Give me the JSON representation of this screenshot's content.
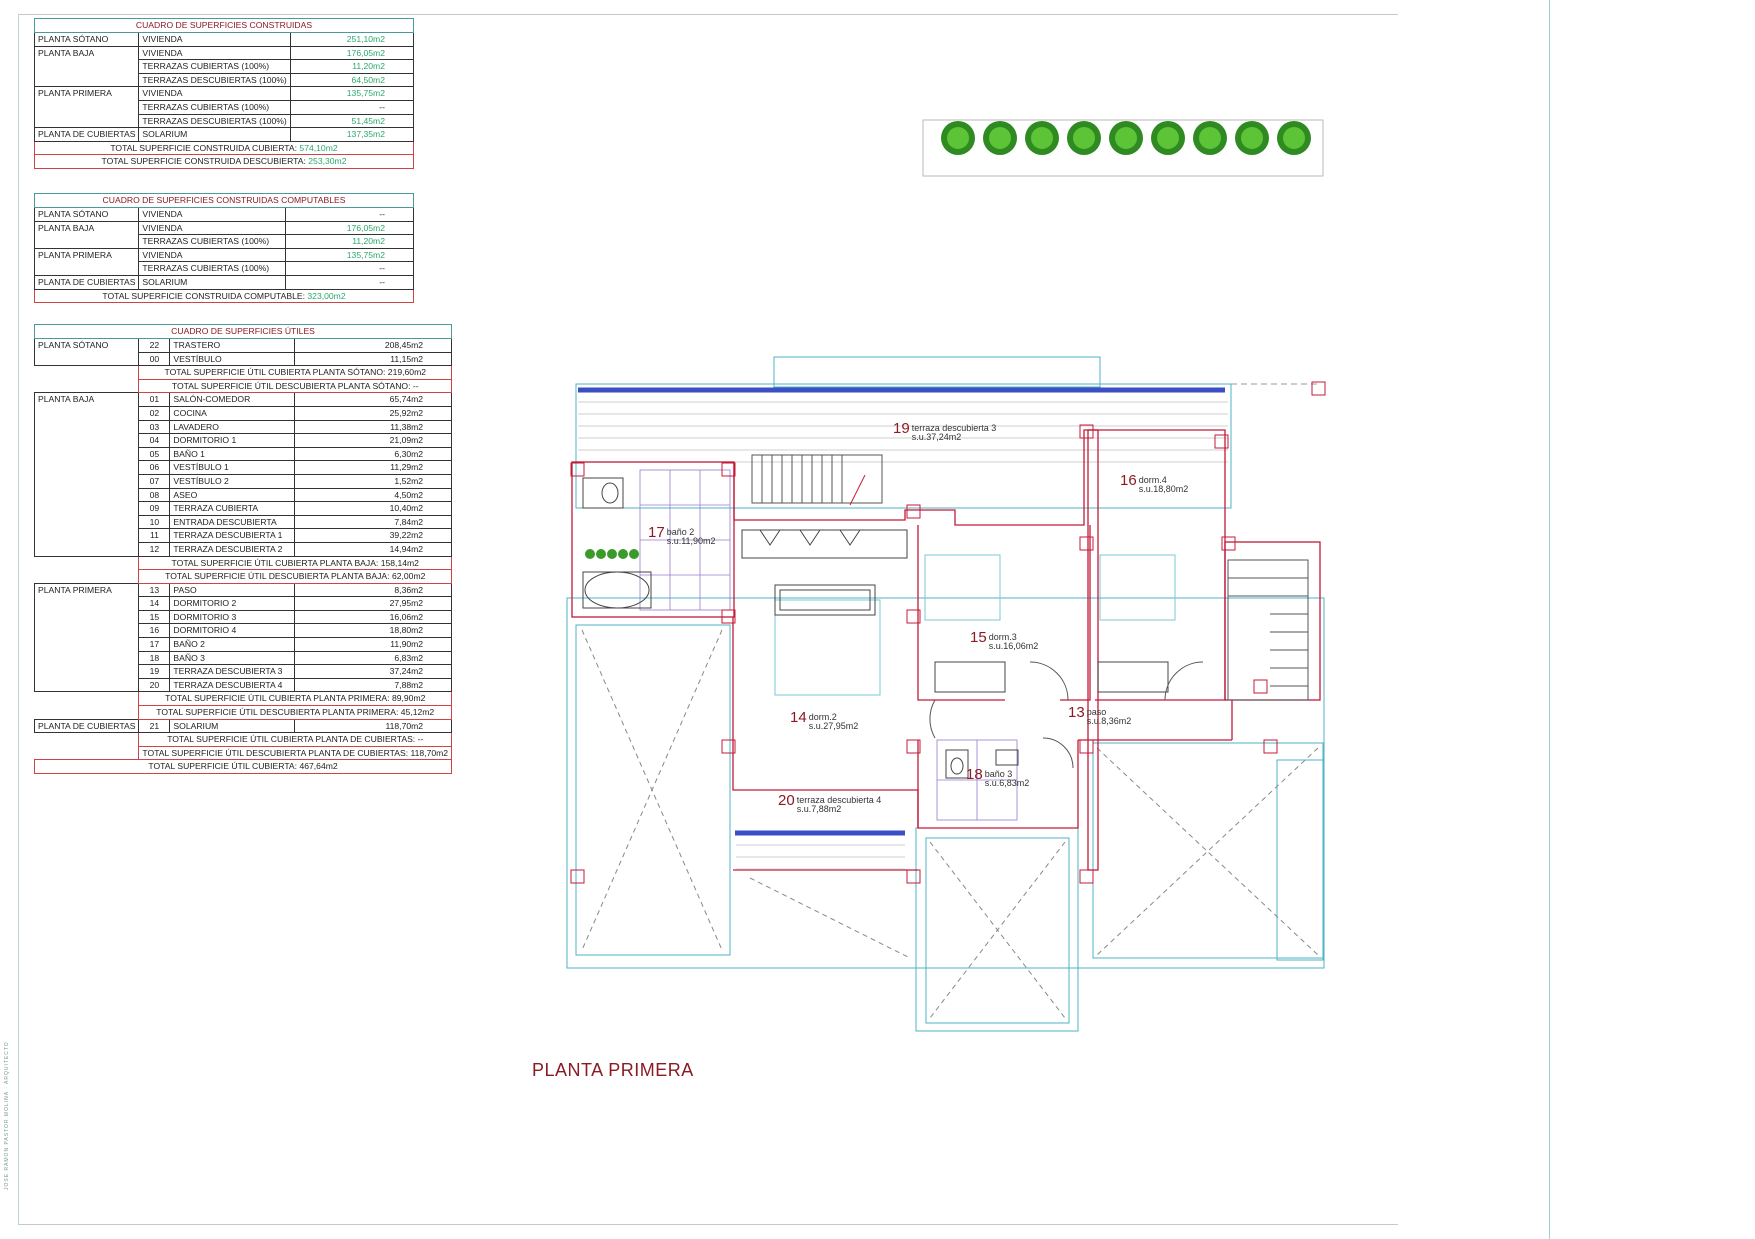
{
  "tables": {
    "construidas": {
      "title": "CUADRO DE SUPERFICIES CONSTRUIDAS",
      "groups": [
        {
          "floor": "PLANTA SÓTANO",
          "rows": [
            {
              "label": "VIVIENDA",
              "value": "251,10m2"
            }
          ]
        },
        {
          "floor": "PLANTA BAJA",
          "rows": [
            {
              "label": "VIVIENDA",
              "value": "176,05m2"
            },
            {
              "label": "TERRAZAS CUBIERTAS (100%)",
              "value": "11,20m2"
            },
            {
              "label": "TERRAZAS DESCUBIERTAS (100%)",
              "value": "64,50m2"
            }
          ]
        },
        {
          "floor": "PLANTA PRIMERA",
          "rows": [
            {
              "label": "VIVIENDA",
              "value": "135,75m2"
            },
            {
              "label": "TERRAZAS CUBIERTAS (100%)",
              "value": "--"
            },
            {
              "label": "TERRAZAS DESCUBIERTAS (100%)",
              "value": "51,45m2"
            }
          ]
        },
        {
          "floor": "PLANTA DE CUBIERTAS",
          "rows": [
            {
              "label": "SOLARIUM",
              "value": "137,35m2"
            }
          ]
        }
      ],
      "totals": [
        {
          "label": "TOTAL SUPERFICIE CONSTRUIDA CUBIERTA:",
          "value": "574,10m2"
        },
        {
          "label": "TOTAL SUPERFICIE CONSTRUIDA DESCUBIERTA:",
          "value": "253,30m2"
        }
      ]
    },
    "computables": {
      "title": "CUADRO DE SUPERFICIES CONSTRUIDAS COMPUTABLES",
      "groups": [
        {
          "floor": "PLANTA SÓTANO",
          "rows": [
            {
              "label": "VIVIENDA",
              "value": "--"
            }
          ]
        },
        {
          "floor": "PLANTA BAJA",
          "rows": [
            {
              "label": "VIVIENDA",
              "value": "176,05m2"
            },
            {
              "label": "TERRAZAS CUBIERTAS (100%)",
              "value": "11,20m2"
            }
          ]
        },
        {
          "floor": "PLANTA PRIMERA",
          "rows": [
            {
              "label": "VIVIENDA",
              "value": "135,75m2"
            },
            {
              "label": "TERRAZAS CUBIERTAS (100%)",
              "value": "--"
            }
          ]
        },
        {
          "floor": "PLANTA DE CUBIERTAS",
          "rows": [
            {
              "label": "SOLARIUM",
              "value": "--"
            }
          ]
        }
      ],
      "totals": [
        {
          "label": "TOTAL SUPERFICIE CONSTRUIDA COMPUTABLE:",
          "value": "323,00m2"
        }
      ]
    },
    "utiles": {
      "title": "CUADRO DE SUPERFICIES ÚTILES",
      "groups": [
        {
          "floor": "PLANTA SÓTANO",
          "rows": [
            {
              "num": "22",
              "label": "TRASTERO",
              "value": "208,45m2"
            },
            {
              "num": "00",
              "label": "VESTÍBULO",
              "value": "11,15m2"
            }
          ],
          "totals": [
            {
              "label": "TOTAL SUPERFICIE ÚTIL CUBIERTA PLANTA SÓTANO:",
              "value": "219,60m2"
            },
            {
              "label": "TOTAL SUPERFICIE ÚTIL DESCUBIERTA PLANTA SÓTANO:",
              "value": "--"
            }
          ]
        },
        {
          "floor": "PLANTA BAJA",
          "rows": [
            {
              "num": "01",
              "label": "SALÓN-COMEDOR",
              "value": "65,74m2"
            },
            {
              "num": "02",
              "label": "COCINA",
              "value": "25,92m2"
            },
            {
              "num": "03",
              "label": "LAVADERO",
              "value": "11,38m2"
            },
            {
              "num": "04",
              "label": "DORMITORIO 1",
              "value": "21,09m2"
            },
            {
              "num": "05",
              "label": "BAÑO 1",
              "value": "6,30m2"
            },
            {
              "num": "06",
              "label": "VESTÍBULO 1",
              "value": "11,29m2"
            },
            {
              "num": "07",
              "label": "VESTÍBULO 2",
              "value": "1,52m2"
            },
            {
              "num": "08",
              "label": "ASEO",
              "value": "4,50m2"
            },
            {
              "num": "09",
              "label": "TERRAZA CUBIERTA",
              "value": "10,40m2"
            },
            {
              "num": "10",
              "label": "ENTRADA DESCUBIERTA",
              "value": "7,84m2"
            },
            {
              "num": "11",
              "label": "TERRAZA DESCUBIERTA 1",
              "value": "39,22m2"
            },
            {
              "num": "12",
              "label": "TERRAZA DESCUBIERTA 2",
              "value": "14,94m2"
            }
          ],
          "totals": [
            {
              "label": "TOTAL SUPERFICIE ÚTIL CUBIERTA PLANTA BAJA:",
              "value": "158,14m2"
            },
            {
              "label": "TOTAL SUPERFICIE ÚTIL DESCUBIERTA PLANTA BAJA:",
              "value": "62,00m2"
            }
          ]
        },
        {
          "floor": "PLANTA PRIMERA",
          "rows": [
            {
              "num": "13",
              "label": "PASO",
              "value": "8,36m2"
            },
            {
              "num": "14",
              "label": "DORMITORIO 2",
              "value": "27,95m2"
            },
            {
              "num": "15",
              "label": "DORMITORIO 3",
              "value": "16,06m2"
            },
            {
              "num": "16",
              "label": "DORMITORIO 4",
              "value": "18,80m2"
            },
            {
              "num": "17",
              "label": "BAÑO 2",
              "value": "11,90m2"
            },
            {
              "num": "18",
              "label": "BAÑO 3",
              "value": "6,83m2"
            },
            {
              "num": "19",
              "label": "TERRAZA DESCUBIERTA 3",
              "value": "37,24m2"
            },
            {
              "num": "20",
              "label": "TERRAZA DESCUBIERTA 4",
              "value": "7,88m2"
            }
          ],
          "totals": [
            {
              "label": "TOTAL SUPERFICIE ÚTIL CUBIERTA PLANTA PRIMERA:",
              "value": "89,90m2"
            },
            {
              "label": "TOTAL SUPERFICIE ÚTIL DESCUBIERTA PLANTA PRIMERA:",
              "value": "45,12m2"
            }
          ]
        },
        {
          "floor": "PLANTA DE CUBIERTAS",
          "rows": [
            {
              "num": "21",
              "label": "SOLARIUM",
              "value": "118,70m2"
            }
          ],
          "totals": [
            {
              "label": "TOTAL SUPERFICIE ÚTIL CUBIERTA PLANTA DE CUBIERTAS:",
              "value": "--"
            },
            {
              "label": "TOTAL SUPERFICIE ÚTIL DESCUBIERTA PLANTA DE CUBIERTAS:",
              "value": "118,70m2"
            }
          ]
        }
      ],
      "grand_total": {
        "label": "TOTAL SUPERFICIE ÚTIL CUBIERTA:",
        "value": "467,64m2"
      }
    }
  },
  "rooms": {
    "r19": {
      "num": "19",
      "name": "terraza descubierta 3",
      "area": "s.u.37,24m2"
    },
    "r16": {
      "num": "16",
      "name": "dorm.4",
      "area": "s.u.18,80m2"
    },
    "r17": {
      "num": "17",
      "name": "baño 2",
      "area": "s.u.11,90m2"
    },
    "r15": {
      "num": "15",
      "name": "dorm.3",
      "area": "s.u.16,06m2"
    },
    "r14": {
      "num": "14",
      "name": "dorm.2",
      "area": "s.u.27,95m2"
    },
    "r13": {
      "num": "13",
      "name": "paso",
      "area": "s.u.8,36m2"
    },
    "r18": {
      "num": "18",
      "name": "baño 3",
      "area": "s.u.6,83m2"
    },
    "r20": {
      "num": "20",
      "name": "terraza descubierta 4",
      "area": "s.u.7,88m2"
    }
  },
  "plan_title": "PLANTA PRIMERA",
  "side_strip": "JOSE RAMON PASTOR MOLINA · ARQUITECTO",
  "colors": {
    "wall_red": "#c41a3a",
    "cyan": "#4fb3c4",
    "blue": "#3a4fc4",
    "green": "#2aa86a",
    "title_red": "#8a1a24"
  }
}
